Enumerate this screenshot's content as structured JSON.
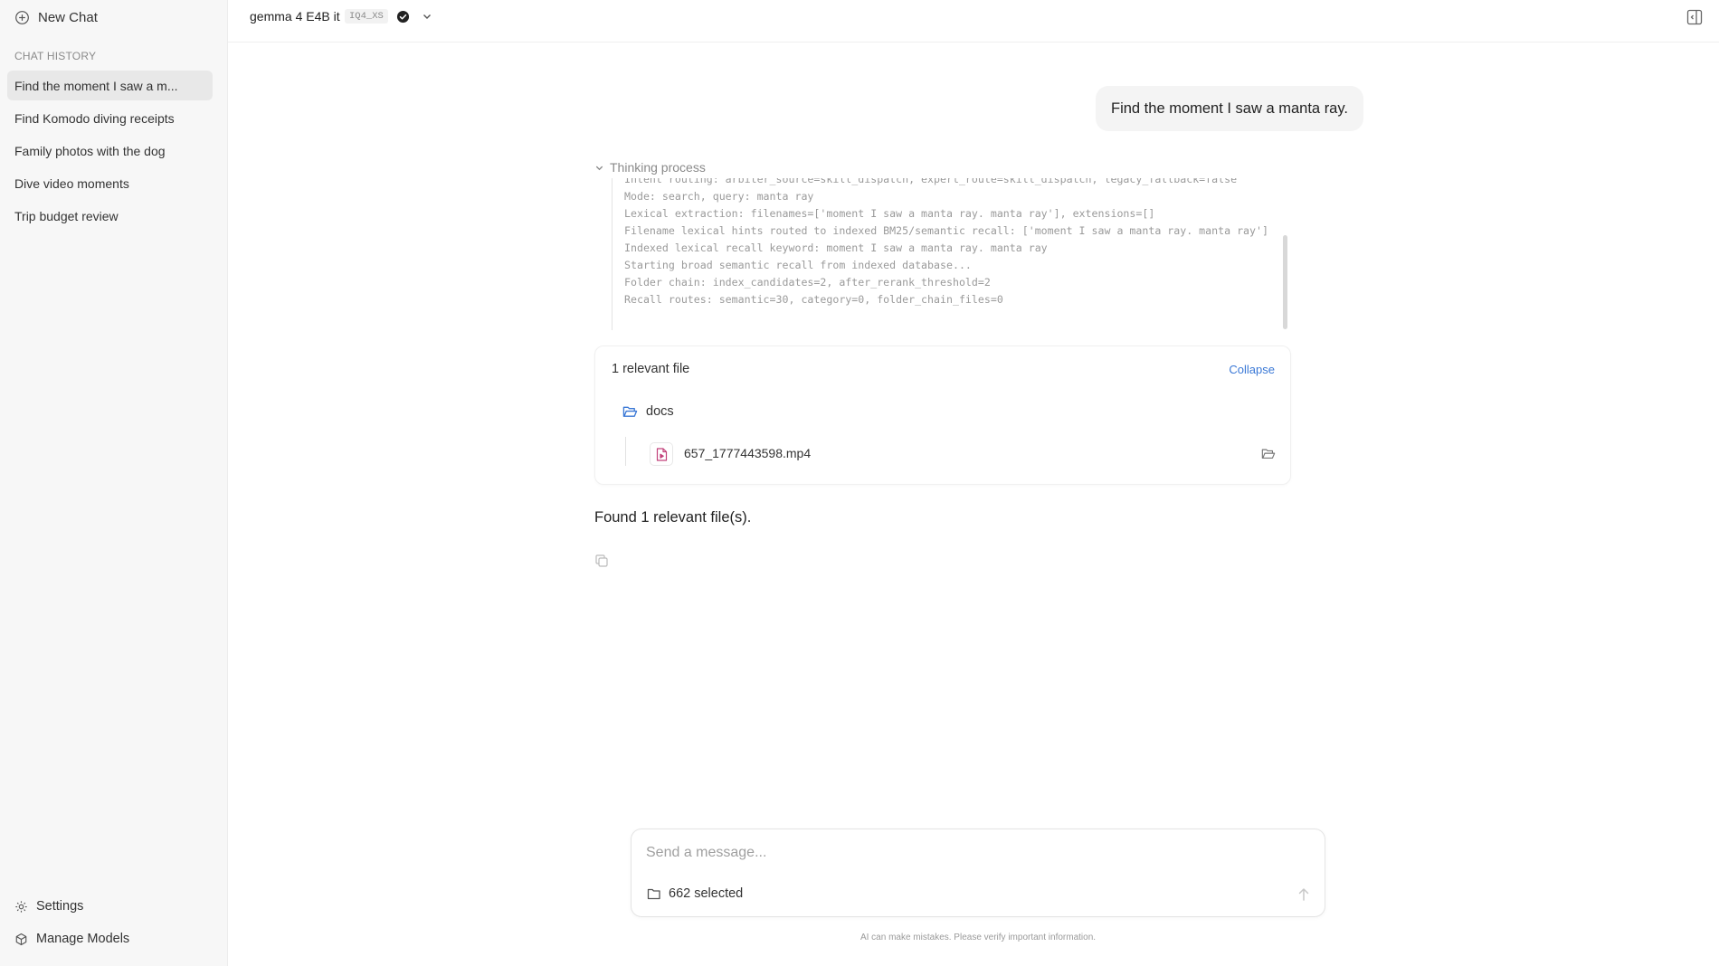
{
  "sidebar": {
    "new_chat_label": "New Chat",
    "history_label": "CHAT HISTORY",
    "items": [
      {
        "label": "Find the moment I saw a m..."
      },
      {
        "label": "Find Komodo diving receipts"
      },
      {
        "label": "Family photos with the dog"
      },
      {
        "label": "Dive video moments"
      },
      {
        "label": "Trip budget review"
      }
    ],
    "settings_label": "Settings",
    "manage_models_label": "Manage Models"
  },
  "header": {
    "model_name": "gemma 4 E4B it",
    "model_tag": "IQ4_XS"
  },
  "chat": {
    "user_message": "Find the moment I saw a manta ray.",
    "thinking_label": "Thinking process",
    "thinking_log": [
      "Intent routing: arbiter_source=skill_dispatch, expert_route=skill_dispatch, legacy_fallback=false",
      "Mode: search, query: manta ray",
      "Lexical extraction: filenames=['moment I saw a manta ray. manta ray'], extensions=[]",
      "Filename lexical hints routed to indexed BM25/semantic recall: ['moment I saw a manta ray. manta ray']",
      "Indexed lexical recall keyword: moment I saw a manta ray. manta ray",
      "Starting broad semantic recall from indexed database...",
      "Folder chain: index_candidates=2, after_rerank_threshold=2",
      "Recall routes: semantic=30, category=0, folder_chain_files=0"
    ],
    "files": {
      "title": "1 relevant file",
      "collapse_label": "Collapse",
      "folder": "docs",
      "file_name": "657_1777443598.mp4"
    },
    "answer": "Found 1 relevant file(s)."
  },
  "composer": {
    "placeholder": "Send a message...",
    "scope_label": "662 selected",
    "disclaimer": "AI can make mistakes. Please verify important information."
  },
  "colors": {
    "accent": "#3a78d6",
    "file_icon": "#c2417a",
    "sidebar_bg": "#f7f7f7"
  }
}
